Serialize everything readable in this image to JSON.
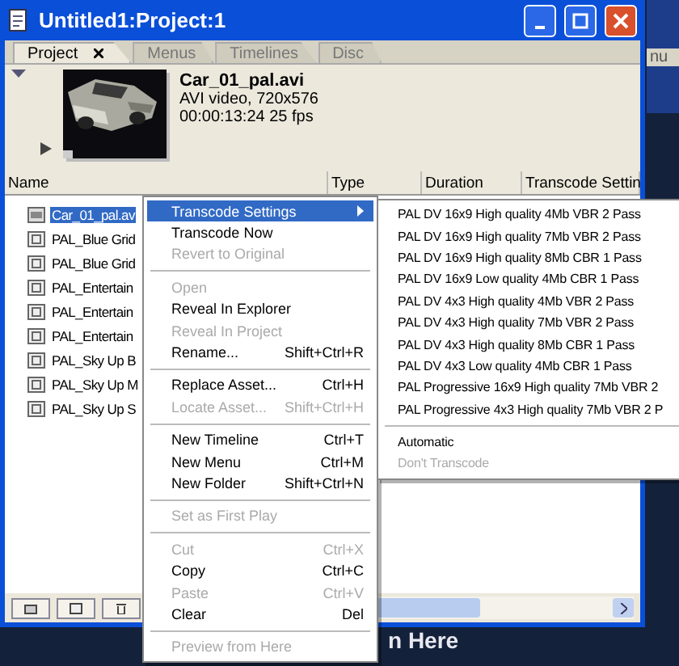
{
  "window": {
    "title": "Untitled1:Project:1"
  },
  "tabs": [
    {
      "label": "Project",
      "selected": true,
      "closable": true
    },
    {
      "label": "Menus",
      "selected": false,
      "closable": false
    },
    {
      "label": "Timelines",
      "selected": false,
      "closable": false
    },
    {
      "label": "Disc",
      "selected": false,
      "closable": false
    }
  ],
  "preview": {
    "name": "Car_01_pal.avi",
    "info": "AVI video, 720x576",
    "duration": "00:00:13:24 25 fps"
  },
  "table": {
    "columns": [
      "Name",
      "Type",
      "Duration",
      "Transcode Settin"
    ],
    "rows": [
      {
        "name": "Car_01_pal.av",
        "kind": "video",
        "selected": true
      },
      {
        "name": "PAL_Blue Grid",
        "kind": "menu",
        "selected": false
      },
      {
        "name": "PAL_Blue Grid",
        "kind": "menu",
        "selected": false
      },
      {
        "name": "PAL_Entertain",
        "kind": "menu",
        "selected": false
      },
      {
        "name": "PAL_Entertain",
        "kind": "menu",
        "selected": false
      },
      {
        "name": "PAL_Entertain",
        "kind": "menu",
        "selected": false
      },
      {
        "name": "PAL_Sky Up B",
        "kind": "menu",
        "selected": false
      },
      {
        "name": "PAL_Sky Up M",
        "kind": "menu",
        "selected": false
      },
      {
        "name": "PAL_Sky Up S",
        "kind": "menu",
        "selected": false
      }
    ]
  },
  "context_menu": {
    "items": [
      {
        "kind": "item",
        "label": "Transcode Settings",
        "submenu": true,
        "disabled": false,
        "selected": true
      },
      {
        "kind": "item",
        "label": "Transcode Now",
        "disabled": false,
        "selected": false
      },
      {
        "kind": "item",
        "label": "Revert to Original",
        "disabled": true,
        "selected": false
      },
      {
        "kind": "separator"
      },
      {
        "kind": "item",
        "label": "Open",
        "disabled": true,
        "selected": false
      },
      {
        "kind": "item",
        "label": "Reveal In Explorer",
        "disabled": false,
        "selected": false
      },
      {
        "kind": "item",
        "label": "Reveal In Project",
        "disabled": true,
        "selected": false
      },
      {
        "kind": "item",
        "label": "Rename...",
        "shortcut": "Shift+Ctrl+R",
        "disabled": false,
        "selected": false
      },
      {
        "kind": "separator"
      },
      {
        "kind": "item",
        "label": "Replace Asset...",
        "shortcut": "Ctrl+H",
        "disabled": false,
        "selected": false
      },
      {
        "kind": "item",
        "label": "Locate Asset...",
        "shortcut": "Shift+Ctrl+H",
        "disabled": true,
        "selected": false
      },
      {
        "kind": "separator"
      },
      {
        "kind": "item",
        "label": "New Timeline",
        "shortcut": "Ctrl+T",
        "disabled": false,
        "selected": false
      },
      {
        "kind": "item",
        "label": "New Menu",
        "shortcut": "Ctrl+M",
        "disabled": false,
        "selected": false
      },
      {
        "kind": "item",
        "label": "New Folder",
        "shortcut": "Shift+Ctrl+N",
        "disabled": false,
        "selected": false
      },
      {
        "kind": "separator"
      },
      {
        "kind": "item",
        "label": "Set as First Play",
        "disabled": true,
        "selected": false
      },
      {
        "kind": "separator"
      },
      {
        "kind": "item",
        "label": "Cut",
        "shortcut": "Ctrl+X",
        "disabled": true,
        "selected": false
      },
      {
        "kind": "item",
        "label": "Copy",
        "shortcut": "Ctrl+C",
        "disabled": false,
        "selected": false
      },
      {
        "kind": "item",
        "label": "Paste",
        "shortcut": "Ctrl+V",
        "disabled": true,
        "selected": false
      },
      {
        "kind": "item",
        "label": "Clear",
        "shortcut": "Del",
        "disabled": false,
        "selected": false
      },
      {
        "kind": "separator"
      },
      {
        "kind": "item",
        "label": "Preview from Here",
        "disabled": true,
        "selected": false
      }
    ]
  },
  "submenu": {
    "items": [
      {
        "kind": "item",
        "label": "PAL DV 16x9 High quality 4Mb VBR 2 Pass",
        "disabled": false,
        "selected": false
      },
      {
        "kind": "item",
        "label": "PAL DV 16x9 High quality 7Mb VBR 2 Pass",
        "disabled": false,
        "selected": false
      },
      {
        "kind": "item",
        "label": "PAL DV 16x9 High quality 8Mb CBR 1 Pass",
        "disabled": false,
        "selected": false
      },
      {
        "kind": "item",
        "label": "PAL DV 16x9 Low quality 4Mb CBR 1 Pass",
        "disabled": false,
        "selected": false
      },
      {
        "kind": "item",
        "label": "PAL DV 4x3 High quality 4Mb VBR 2 Pass",
        "disabled": false,
        "selected": false
      },
      {
        "kind": "item",
        "label": "PAL DV 4x3 High quality 7Mb VBR 2 Pass",
        "disabled": false,
        "selected": false
      },
      {
        "kind": "item",
        "label": "PAL DV 4x3 High quality 8Mb CBR 1 Pass",
        "disabled": false,
        "selected": false
      },
      {
        "kind": "item",
        "label": "PAL DV 4x3 Low quality 4Mb CBR 1 Pass",
        "disabled": false,
        "selected": false
      },
      {
        "kind": "item",
        "label": "PAL Progressive 16x9 High quality 7Mb VBR 2",
        "disabled": false,
        "selected": false
      },
      {
        "kind": "item",
        "label": "PAL Progressive 4x3 High quality 7Mb VBR 2 P",
        "disabled": false,
        "selected": false
      },
      {
        "kind": "separator"
      },
      {
        "kind": "item",
        "label": "Automatic",
        "disabled": false,
        "selected": false
      },
      {
        "kind": "item",
        "label": "Don't Transcode",
        "disabled": true,
        "selected": false
      }
    ]
  },
  "background": {
    "tab": "nu",
    "text": "n Here"
  }
}
